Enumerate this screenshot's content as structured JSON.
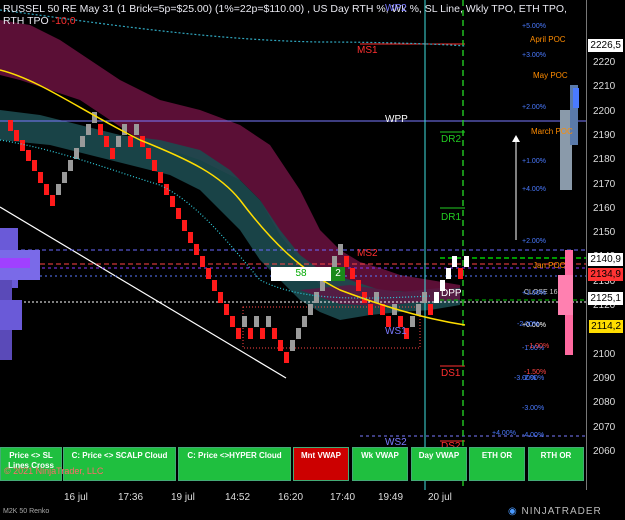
{
  "header": {
    "title_main": "RUSSEL 50 RE May 31 (1 Brick=5p=$25.00) (1%=22p=$110.00) , US Day RTH %, Wk %, SL Line, Wkly TPO, ETH TPO,",
    "title_second": "RTH TPO",
    "title_value": "-10,0"
  },
  "levels": {
    "wp2": "WP2",
    "ms1": "MS1",
    "wpp": "WPP",
    "dr2": "DR2",
    "dr1": "DR1",
    "ms2": "MS2",
    "dpp": "DPP",
    "ws1": "WS1",
    "ds1": "DS1",
    "ws2": "WS2",
    "ds2": "DS2",
    "april_poc": "April POC",
    "may_poc": "May POC",
    "march_poc": "March POC",
    "jan_poc": "Jan POC",
    "close": "CLOSE 16"
  },
  "percent_labels": [
    "+5.00%",
    "+3.00%",
    "+2.00%",
    "+1.00%",
    "+4.00%",
    "+2.00%",
    "+1.00%",
    "+0.00%",
    "-1.00%",
    "-2.00%",
    "-3.00%",
    "-4.00%"
  ],
  "side_percent": {
    "p1": "+4.00%",
    "p2": "+2.00%",
    "p3": "+1.00%",
    "p4": "-1.00%",
    "p5": "-2.00%",
    "p6": "-1.50%",
    "p7": "-3.00%",
    "p8": "-1.00%"
  },
  "panel": {
    "left_value": "58",
    "right_value": "2"
  },
  "yaxis": {
    "ticks": [
      "2220",
      "2210",
      "2200",
      "2190",
      "2180",
      "2170",
      "2160",
      "2150",
      "2140",
      "2130",
      "2120",
      "2110",
      "2100",
      "2090",
      "2080",
      "2070",
      "2060"
    ],
    "tags": {
      "t1": {
        "value": "2226,5",
        "bg": "#ffffff",
        "fg": "#000000"
      },
      "t2": {
        "value": "2140,9",
        "bg": "#ffffff",
        "fg": "#000000"
      },
      "t3": {
        "value": "2134,9",
        "bg": "#ff3333",
        "fg": "#000000"
      },
      "t4": {
        "value": "2125,1",
        "bg": "#ffffff",
        "fg": "#000000"
      },
      "t5": {
        "value": "2114,2",
        "bg": "#ffdd00",
        "fg": "#000000"
      }
    }
  },
  "xaxis": {
    "labels": [
      "16 jul",
      "17:36",
      "19 jul",
      "14:52",
      "16:20",
      "17:40",
      "19:49",
      "20 jul"
    ]
  },
  "buttons": {
    "b1": "Price <> SL Lines Cross",
    "b2": "C: Price <> SCALP Cloud",
    "b3": "C: Price <>HYPER Cloud",
    "b4": "Mnt VWAP",
    "b5": "Wk VWAP",
    "b6": "Day VWAP",
    "b7": "ETH OR",
    "b8": "RTH OR"
  },
  "footer": {
    "copyright": "© 2021 NinjaTrader, LLC",
    "instrument_label": "M2K 50 Renko",
    "brand": "NINJATRADER"
  },
  "colors": {
    "up": "#9a9a9a",
    "down": "#ff1a1a",
    "accent": "#1e90ff",
    "vwap": "#ffdd00"
  }
}
